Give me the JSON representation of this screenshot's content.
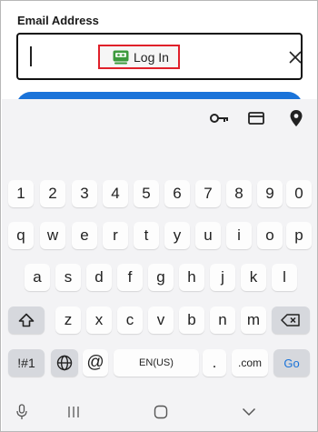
{
  "form": {
    "email_label": "Email Address",
    "email_value": "",
    "email_placeholder": ""
  },
  "toolbar": {
    "icons": [
      "key-icon",
      "card-icon",
      "location-pin-icon"
    ]
  },
  "suggestion": {
    "login_label": "Log In"
  },
  "keyboard": {
    "number_row": [
      "1",
      "2",
      "3",
      "4",
      "5",
      "6",
      "7",
      "8",
      "9",
      "0"
    ],
    "row1": [
      "q",
      "w",
      "e",
      "r",
      "t",
      "y",
      "u",
      "i",
      "o",
      "p"
    ],
    "row2": [
      "a",
      "s",
      "d",
      "f",
      "g",
      "h",
      "j",
      "k",
      "l"
    ],
    "row3": [
      "z",
      "x",
      "c",
      "v",
      "b",
      "n",
      "m"
    ],
    "symbols_label": "!#1",
    "at_label": "@",
    "space_label": "EN(US)",
    "period_label": ".",
    "com_label": ".com",
    "go_label": "Go"
  },
  "colors": {
    "accent": "#1a73d9",
    "highlight_border": "#e0202a",
    "keyboard_bg": "#f3f3f5"
  }
}
